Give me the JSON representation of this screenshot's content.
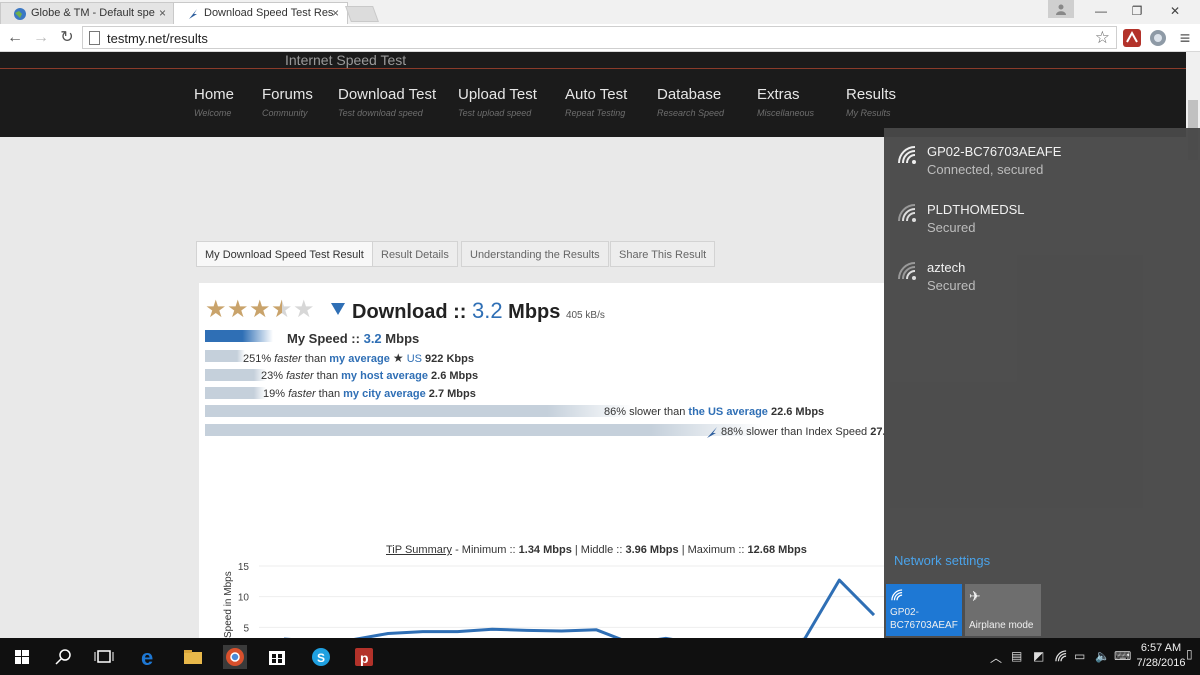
{
  "browser": {
    "tabs": [
      {
        "title": "Globe & TM - Default spe",
        "active": false
      },
      {
        "title": "Download Speed Test Res",
        "active": true
      }
    ],
    "url": "testmy.net/results"
  },
  "site": {
    "title": "Internet Speed Test",
    "nav": [
      {
        "label": "Home",
        "sub": "Welcome"
      },
      {
        "label": "Forums",
        "sub": "Community"
      },
      {
        "label": "Download Test",
        "sub": "Test download speed"
      },
      {
        "label": "Upload Test",
        "sub": "Test upload speed"
      },
      {
        "label": "Auto Test",
        "sub": "Repeat Testing"
      },
      {
        "label": "Database",
        "sub": "Research Speed"
      },
      {
        "label": "Extras",
        "sub": "Miscellaneous"
      },
      {
        "label": "Results",
        "sub": "My Results"
      }
    ],
    "content_tabs": [
      "My Download Speed Test Result",
      "Result Details",
      "Understanding the Results",
      "Share This Result"
    ]
  },
  "result": {
    "rating_stars": 3.5,
    "heading_prefix": "Download ::",
    "speed_value": "3.2",
    "speed_unit": "Mbps",
    "speed_kbs": "405 kB/s",
    "my_speed_label": "My Speed ::",
    "my_speed_value": "3.2",
    "my_speed_unit": "Mbps",
    "comparisons": [
      {
        "pct": "251%",
        "dir": "faster",
        "than": "than",
        "ref": "my average",
        "mid": "US",
        "val": "922 Kbps",
        "fill": 0.05
      },
      {
        "pct": "23%",
        "dir": "faster",
        "than": "than",
        "ref": "my host average",
        "mid": "",
        "val": "2.6 Mbps",
        "fill": 0.09
      },
      {
        "pct": "19%",
        "dir": "faster",
        "than": "than",
        "ref": "my city average",
        "mid": "",
        "val": "2.7 Mbps",
        "fill": 0.09
      },
      {
        "pct": "86%",
        "dir": "slower than",
        "than": "",
        "ref": "the US average",
        "mid": "",
        "val": "22.6 Mbps",
        "fill": 0.63
      },
      {
        "pct": "88%",
        "dir": "slower than Index Speed",
        "than": "",
        "ref": "",
        "mid": "",
        "val": "27.",
        "fill": 0.82
      }
    ],
    "tip_summary": {
      "label": "TiP Summary",
      "min_label": "- Minimum ::",
      "min": "1.34 Mbps",
      "mid_label": "| Middle ::",
      "mid": "3.96 Mbps",
      "max_label": "| Maximum ::",
      "max": "12.68 Mbps"
    }
  },
  "chart_data": {
    "type": "line",
    "ylabel": "Speed in Mbps",
    "yticks": [
      "15",
      "10",
      "5"
    ],
    "ylim": [
      0,
      15
    ],
    "grid": true,
    "series": [
      {
        "values": [
          3.1,
          2.7,
          3.0,
          4.0,
          4.3,
          4.3,
          4.7,
          4.5,
          4.4,
          4.6,
          2.4,
          3.2,
          2.3,
          1.5,
          1.9,
          3.1,
          12.7,
          7.0
        ]
      }
    ],
    "color": "#2f6fb5"
  },
  "network": {
    "items": [
      {
        "name": "GP02-BC76703AEAFE",
        "status": "Connected, secured"
      },
      {
        "name": "PLDTHOMEDSL",
        "status": "Secured"
      },
      {
        "name": "aztech",
        "status": "Secured"
      }
    ],
    "settings_label": "Network settings",
    "tiles": [
      {
        "label_line1": "GP02-",
        "label_line2": "BC76703AEAF",
        "active": true
      },
      {
        "label_line1": "",
        "label_line2": "Airplane mode",
        "active": false
      }
    ]
  },
  "taskbar": {
    "time": "6:57 AM",
    "date": "7/28/2016"
  },
  "colors": {
    "accent": "#2f6fb5",
    "win_accent": "#1e78d4",
    "flyout_bg": "#484848"
  }
}
